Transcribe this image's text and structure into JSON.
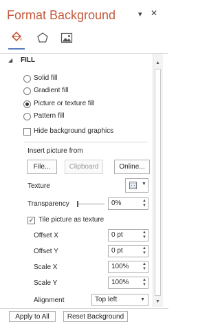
{
  "pane": {
    "title": "Format Background",
    "controls": {
      "options_icon": "chevron-down-icon",
      "close_icon": "close-icon"
    },
    "tabs": [
      {
        "name": "Fill",
        "icon": "paint-bucket-icon",
        "active": true
      },
      {
        "name": "Effects",
        "icon": "pentagon-icon",
        "active": false
      },
      {
        "name": "Picture",
        "icon": "picture-icon",
        "active": false
      }
    ]
  },
  "fill": {
    "section_label": "FILL",
    "options": [
      {
        "label": "Solid fill",
        "selected": false
      },
      {
        "label": "Gradient fill",
        "selected": false
      },
      {
        "label": "Picture or texture fill",
        "selected": true
      },
      {
        "label": "Pattern fill",
        "selected": false
      }
    ],
    "hide_background": {
      "label": "Hide background graphics",
      "checked": false
    },
    "insert_from": {
      "label": "Insert picture from",
      "file_button": "File...",
      "clipboard_button": "Clipboard",
      "online_button": "Online..."
    },
    "texture_label": "Texture",
    "transparency": {
      "label": "Transparency",
      "value": "0%"
    },
    "tile": {
      "label": "Tile picture as texture",
      "checked": true
    },
    "offset_x": {
      "label": "Offset X",
      "value": "0 pt"
    },
    "offset_y": {
      "label": "Offset Y",
      "value": "0 pt"
    },
    "scale_x": {
      "label": "Scale X",
      "value": "100%"
    },
    "scale_y": {
      "label": "Scale Y",
      "value": "100%"
    },
    "alignment": {
      "label": "Alignment",
      "value": "Top left"
    }
  },
  "footer": {
    "apply_all": "Apply to All",
    "reset": "Reset Background"
  },
  "colors": {
    "title": "#c55a3c",
    "accent": "#5a7dbf"
  }
}
